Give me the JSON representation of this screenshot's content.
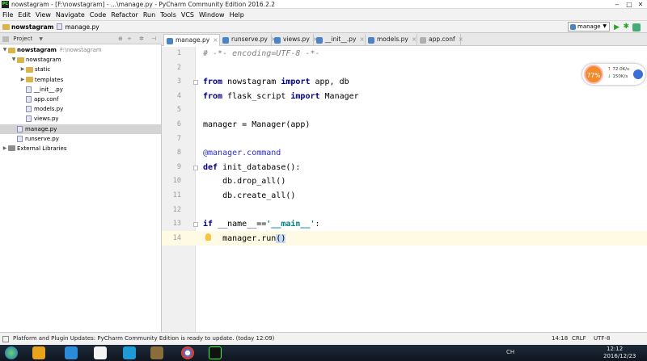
{
  "window": {
    "title": "nowstagram - [F:\\nowstagram] - ...\\manage.py - PyCharm Community Edition 2016.2.2",
    "controls": [
      "‒",
      "□",
      "✕"
    ]
  },
  "menu": [
    "File",
    "Edit",
    "View",
    "Navigate",
    "Code",
    "Refactor",
    "Run",
    "Tools",
    "VCS",
    "Window",
    "Help"
  ],
  "navbar": {
    "breadcrumbs": [
      "nowstagram",
      "manage.py"
    ],
    "run_config": "manage"
  },
  "project_panel": {
    "header": "Project",
    "tree": [
      {
        "label": "nowstagram",
        "hint": "F:\\nowstagram",
        "depth": 0,
        "type": "folder",
        "expanded": true,
        "bold": true
      },
      {
        "label": "nowstagram",
        "depth": 1,
        "type": "folder",
        "expanded": true
      },
      {
        "label": "static",
        "depth": 2,
        "type": "folder"
      },
      {
        "label": "templates",
        "depth": 2,
        "type": "folder"
      },
      {
        "label": "__init__.py",
        "depth": 2,
        "type": "file"
      },
      {
        "label": "app.conf",
        "depth": 2,
        "type": "file"
      },
      {
        "label": "models.py",
        "depth": 2,
        "type": "file"
      },
      {
        "label": "views.py",
        "depth": 2,
        "type": "file"
      },
      {
        "label": "manage.py",
        "depth": 1,
        "type": "file",
        "selected": true
      },
      {
        "label": "runserve.py",
        "depth": 1,
        "type": "file"
      },
      {
        "label": "External Libraries",
        "depth": 0,
        "type": "library",
        "expanded": false
      }
    ]
  },
  "editor_tabs": [
    {
      "label": "manage.py",
      "active": true
    },
    {
      "label": "runserve.py"
    },
    {
      "label": "views.py"
    },
    {
      "label": "__init__.py"
    },
    {
      "label": "models.py"
    },
    {
      "label": "app.conf"
    }
  ],
  "code_lines": [
    {
      "n": "1",
      "code": "# -*- encoding=UTF-8 -*-"
    },
    {
      "n": "2",
      "code": ""
    },
    {
      "n": "3",
      "code": "from nowstagram import app, db"
    },
    {
      "n": "4",
      "code": "from flask_script import Manager"
    },
    {
      "n": "5",
      "code": ""
    },
    {
      "n": "6",
      "code": "manager = Manager(app)"
    },
    {
      "n": "7",
      "code": ""
    },
    {
      "n": "8",
      "code": "@manager.command"
    },
    {
      "n": "9",
      "code": "def init_database():"
    },
    {
      "n": "10",
      "code": "    db.drop_all()"
    },
    {
      "n": "11",
      "code": "    db.create_all()"
    },
    {
      "n": "12",
      "code": ""
    },
    {
      "n": "13",
      "code": "if __name__=='__main__':"
    },
    {
      "n": "14",
      "code": "    manager.run()"
    }
  ],
  "status_bar": {
    "message": "Platform and Plugin Updates: PyCharm Community Edition is ready to update. (today 12:09)",
    "position": "14:18",
    "line_sep": "CRLF",
    "encoding": "UTF-8"
  },
  "net_widget": {
    "percent": "77%",
    "up": "72.0K/s",
    "down": "150K/s"
  },
  "taskbar": {
    "time": "12:12",
    "date": "2016/12/23",
    "lang": "CH"
  }
}
